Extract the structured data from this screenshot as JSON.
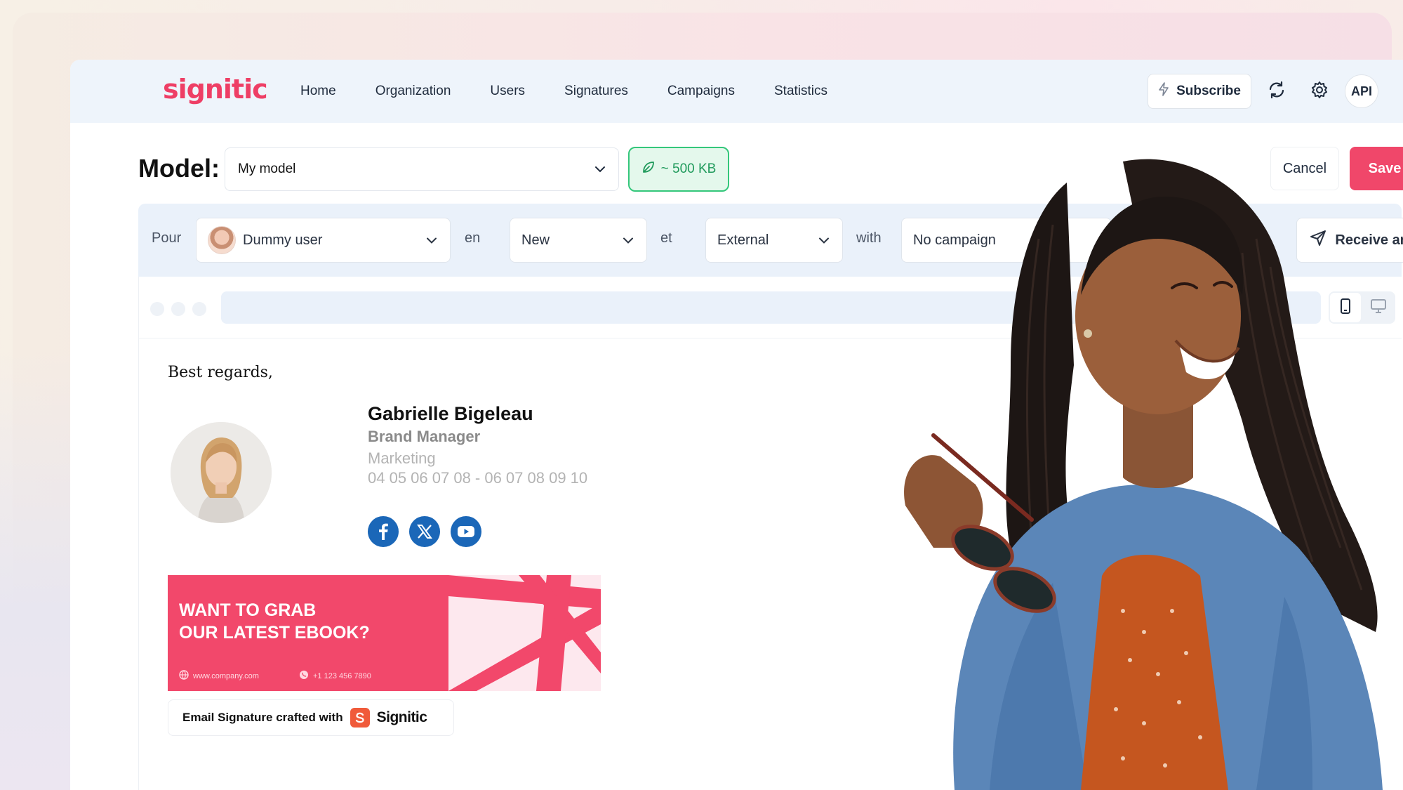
{
  "brand": {
    "logo_text": "signitic",
    "accent": "#f0476a"
  },
  "nav": {
    "items": [
      "Home",
      "Organization",
      "Users",
      "Signatures",
      "Campaigns",
      "Statistics"
    ],
    "subscribe_label": "Subscribe",
    "api_label": "API"
  },
  "model": {
    "label": "Model:",
    "selected": "My model",
    "weight": "~ 500 KB",
    "cancel_label": "Cancel",
    "save_label": "Save"
  },
  "filters": {
    "pour_label": "Pour",
    "user_value": "Dummy user",
    "en_label": "en",
    "status_value": "New",
    "et_label": "et",
    "audience_value": "External",
    "with_label": "with",
    "campaign_value": "No campaign",
    "receive_label": "Receive an email"
  },
  "signature": {
    "greeting": "Best regards,",
    "name": "Gabrielle Bigeleau",
    "role": "Brand Manager",
    "department": "Marketing",
    "phone": "04 05 06 07 08 - 06 07 08 09 10",
    "socials": [
      "facebook-icon",
      "x-icon",
      "youtube-icon"
    ]
  },
  "banner": {
    "line1": "WANT TO GRAB",
    "line2": "OUR LATEST EBOOK?",
    "website": "www.company.com",
    "phone": "+1 123 456 7890"
  },
  "crafted": {
    "text": "Email Signature crafted with",
    "brand": "Signitic"
  }
}
